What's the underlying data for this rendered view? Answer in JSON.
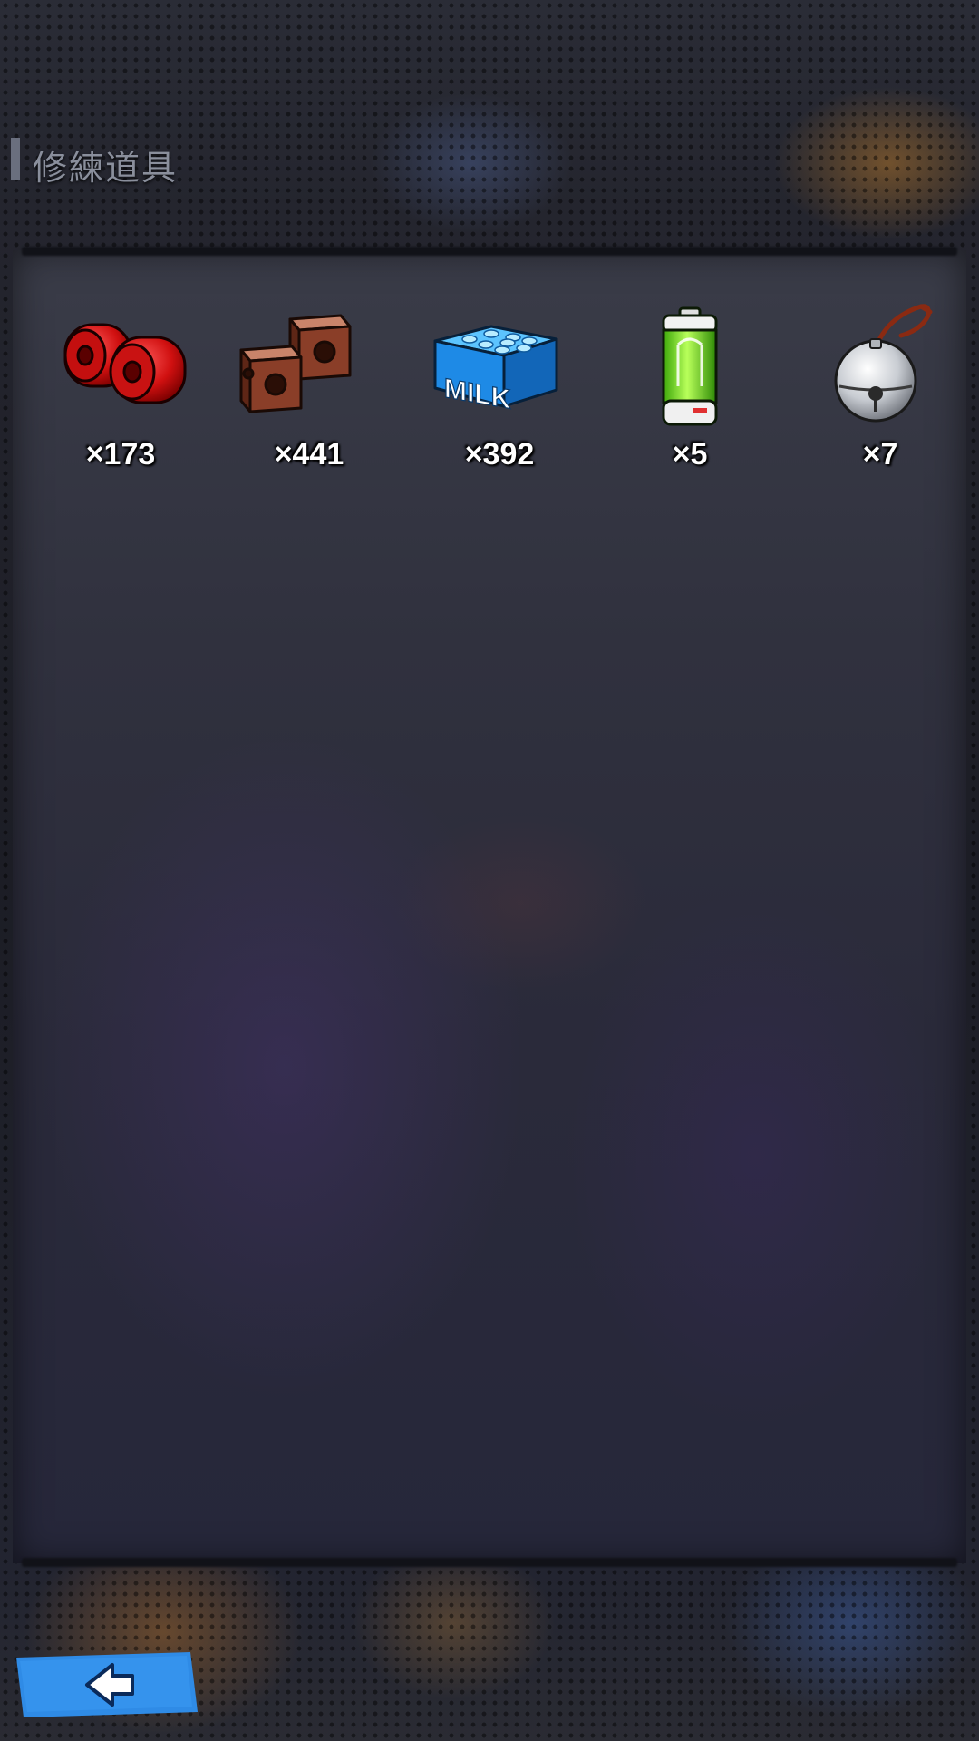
{
  "header": {
    "title": "修練道具"
  },
  "items": [
    {
      "icon": "red-weights-icon",
      "count": "×173"
    },
    {
      "icon": "brick-blocks-icon",
      "count": "×441"
    },
    {
      "icon": "milk-carton-icon",
      "label": "MILK",
      "count": "×392"
    },
    {
      "icon": "battery-icon",
      "count": "×5"
    },
    {
      "icon": "bell-icon",
      "count": "×7"
    }
  ],
  "footer": {
    "back_icon": "back-arrow-icon"
  },
  "colors": {
    "background": "#1a1c24",
    "panel": "#30313e",
    "count_text": "#ffffff",
    "back_button": "#2f8be6"
  }
}
